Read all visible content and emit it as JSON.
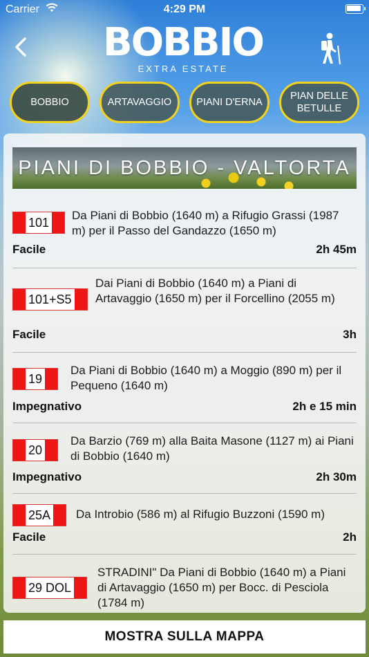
{
  "status_bar": {
    "carrier": "Carrier",
    "time": "4:29 PM"
  },
  "header": {
    "logo_title": "BOBBIO",
    "logo_subtitle": "EXTRA ESTATE",
    "back_icon": "chevron-left-icon",
    "hiker_icon": "hiker-icon"
  },
  "tabs": [
    {
      "label": "BOBBIO",
      "active": true
    },
    {
      "label": "ARTAVAGGIO"
    },
    {
      "label": "PIANI D'ERNA"
    },
    {
      "label": "PIAN DELLE BETULLE"
    }
  ],
  "section_title": "PIANI DI BOBBIO - VALTORTA",
  "routes": [
    {
      "code": "101",
      "description": "Da Piani di Bobbio (1640 m) a Rifugio Grassi (1987 m) per il Passo del Gandazzo (1650 m)",
      "difficulty": "Facile",
      "duration": "2h 45m"
    },
    {
      "code": "101+S5",
      "description": "Dai Piani di Bobbio (1640 m) a Piani di Artavaggio (1650 m) per il Forcellino (2055 m)",
      "difficulty": "Facile",
      "duration": "3h"
    },
    {
      "code": "19",
      "description": "Da Piani di Bobbio (1640 m) a Moggio (890 m) per il Pequeno (1640 m)",
      "difficulty": "Impegnativo",
      "duration": "2h e 15 min"
    },
    {
      "code": "20",
      "description": "Da Barzio (769 m) alla Baita Masone (1127 m) ai Piani di Bobbio (1640 m)",
      "difficulty": "Impegnativo",
      "duration": "2h 30m"
    },
    {
      "code": "25A",
      "description": "Da Introbio (586 m) al Rifugio Buzzoni (1590 m)",
      "difficulty": "Facile",
      "duration": "2h"
    },
    {
      "code": "29 DOL",
      "description": "STRADINI\" Da Piani di Bobbio (1640 m) a Piani di Artavaggio (1650 m) per Bocc. di Pesciola (1784 m)",
      "difficulty": "",
      "duration": ""
    }
  ],
  "map_button_label": "MOSTRA SULLA MAPPA"
}
